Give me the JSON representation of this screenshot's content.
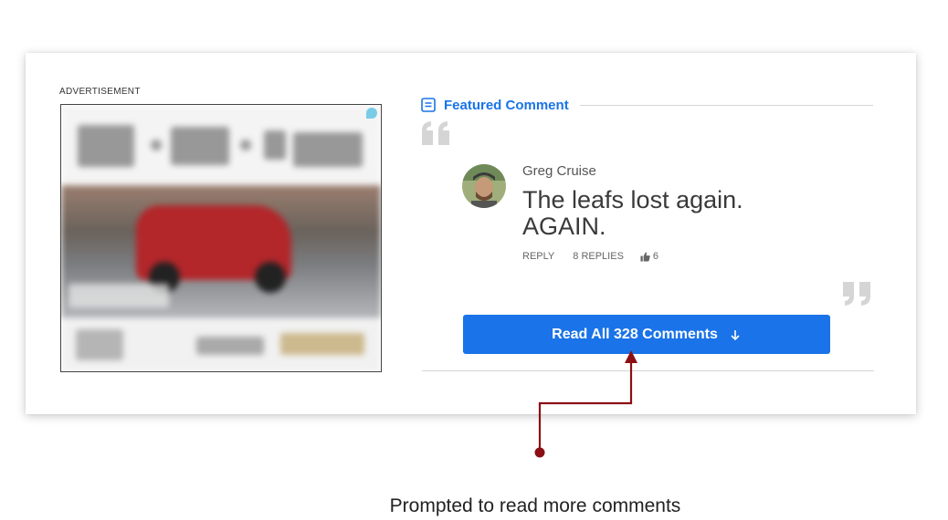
{
  "advertisement": {
    "label": "ADVERTISEMENT"
  },
  "featured": {
    "title": "Featured Comment",
    "icon": "comment-box-icon",
    "accent_color": "#1a73e8"
  },
  "comment": {
    "author": "Greg Cruise",
    "text": "The leafs lost again. AGAIN.",
    "reply_label": "REPLY",
    "replies_label": "8 REPLIES",
    "likes": "6"
  },
  "read_all_button": {
    "label": "Read All 328 Comments",
    "icon": "arrow-down-icon"
  },
  "annotation": {
    "caption": "Prompted to read more comments",
    "pointer_color": "#8b0f14"
  }
}
